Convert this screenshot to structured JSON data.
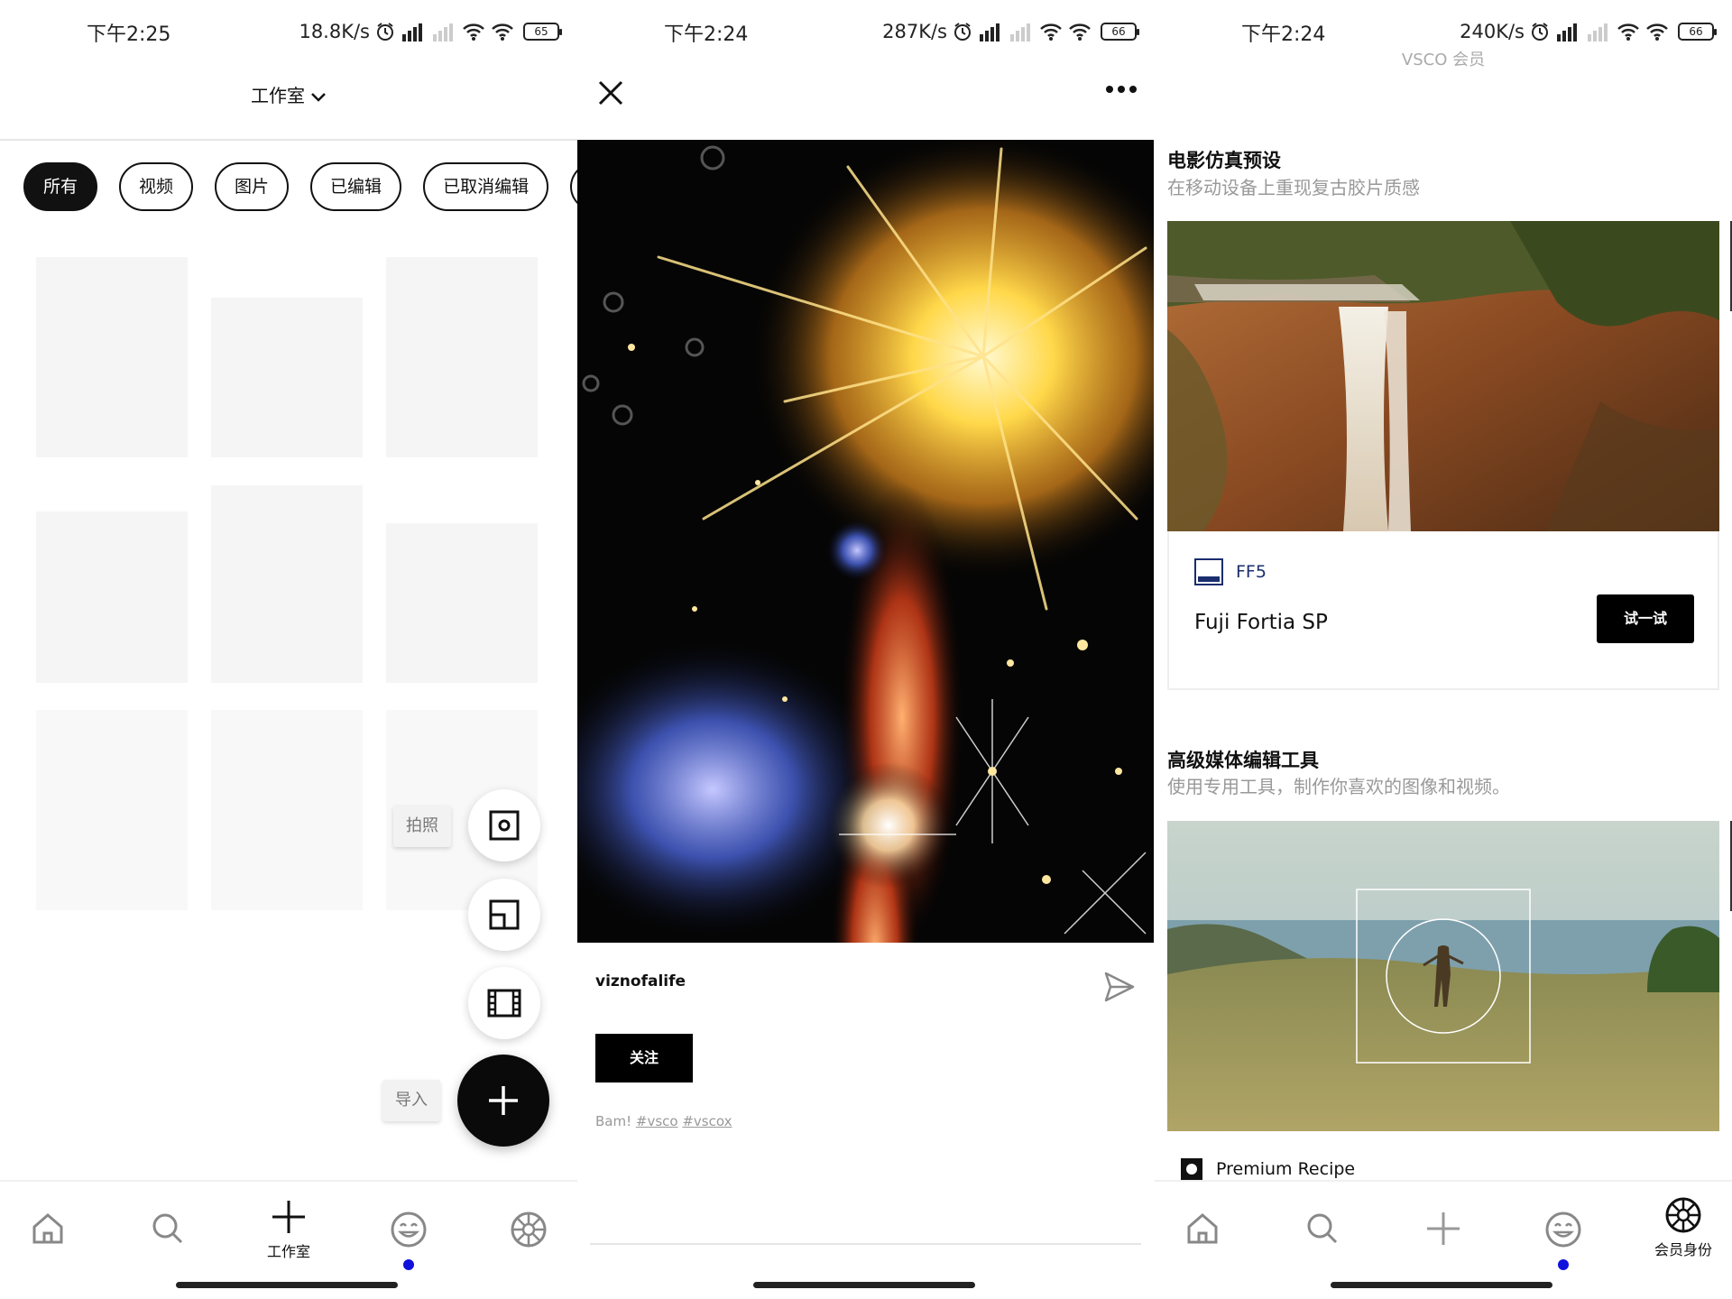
{
  "colors": {
    "accent": "#000000",
    "notification_dot": "#1111dd",
    "preset_blue": "#1a2d6e",
    "placeholder": "#f5f5f5"
  },
  "panel1": {
    "status": {
      "time": "下午2:25",
      "speed": "18.8K/s",
      "battery": "65"
    },
    "title": "工作室",
    "filters": [
      "所有",
      "视频",
      "图片",
      "已编辑",
      "已取消编辑"
    ],
    "active_filter_index": 0,
    "fab": {
      "camera_label": "拍照",
      "import_label": "导入",
      "actions": [
        "camera-icon",
        "layout-icon",
        "film-icon",
        "plus-icon"
      ]
    },
    "nav": {
      "studio_label": "工作室",
      "items": [
        "home-icon",
        "search-icon",
        "plus-icon",
        "smile-icon",
        "aperture-icon"
      ]
    }
  },
  "panel2": {
    "status": {
      "time": "下午2:24",
      "speed": "287K/s",
      "battery": "66"
    },
    "username": "viznofalife",
    "follow_label": "关注",
    "caption_text": "Bam! ",
    "tags": [
      "#vsco",
      "#vscox"
    ]
  },
  "panel3": {
    "status": {
      "time": "下午2:24",
      "speed": "240K/s",
      "battery": "66"
    },
    "header": "VSCO 会员",
    "section1": {
      "title": "电影仿真预设",
      "subtitle": "在移动设备上重现复古胶片质感",
      "preset_code": "FF5",
      "preset_name": "Fuji Fortia SP",
      "try_label": "试一试"
    },
    "section2": {
      "title": "高级媒体编辑工具",
      "subtitle": "使用专用工具，制作你喜欢的图像和视频。",
      "recipe_label": "Premium Recipe"
    },
    "nav": {
      "membership_label": "会员身份"
    }
  }
}
